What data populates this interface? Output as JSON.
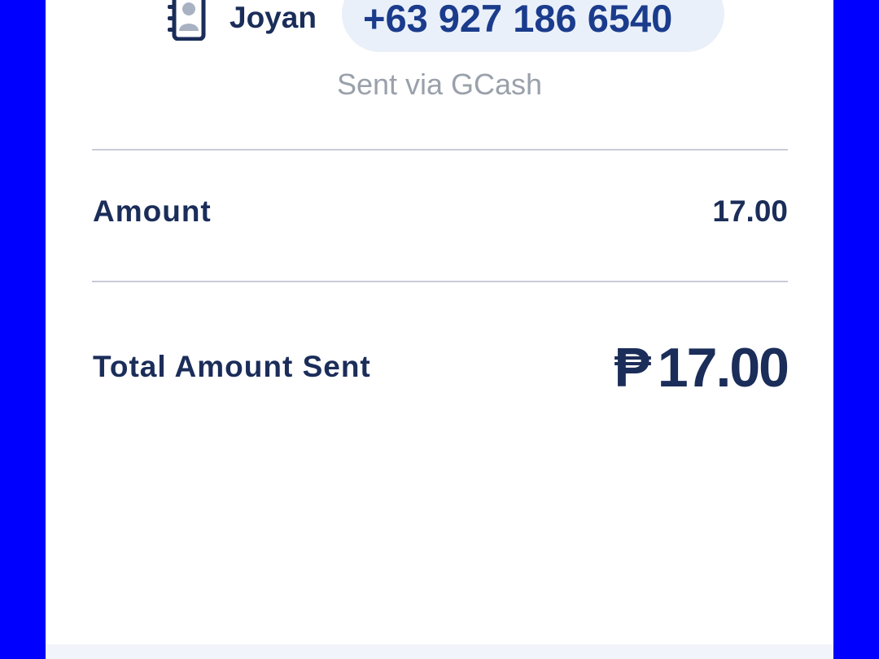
{
  "recipient": {
    "name": "Joyan",
    "phone": "+63 927 186 6540",
    "icon": "contact-book-icon"
  },
  "channel_note": "Sent via GCash",
  "details": {
    "amount_label": "Amount",
    "amount_value": "17.00",
    "total_label": "Total Amount Sent",
    "total_currency": "₱",
    "total_value": "17.00"
  },
  "colors": {
    "background": "#0000ff",
    "card": "#ffffff",
    "text_primary": "#1b2d59",
    "phone_text": "#1b3c8c",
    "phone_pill": "#eaf0f9",
    "muted": "#9aa1ab",
    "divider": "#c7ccd6"
  }
}
